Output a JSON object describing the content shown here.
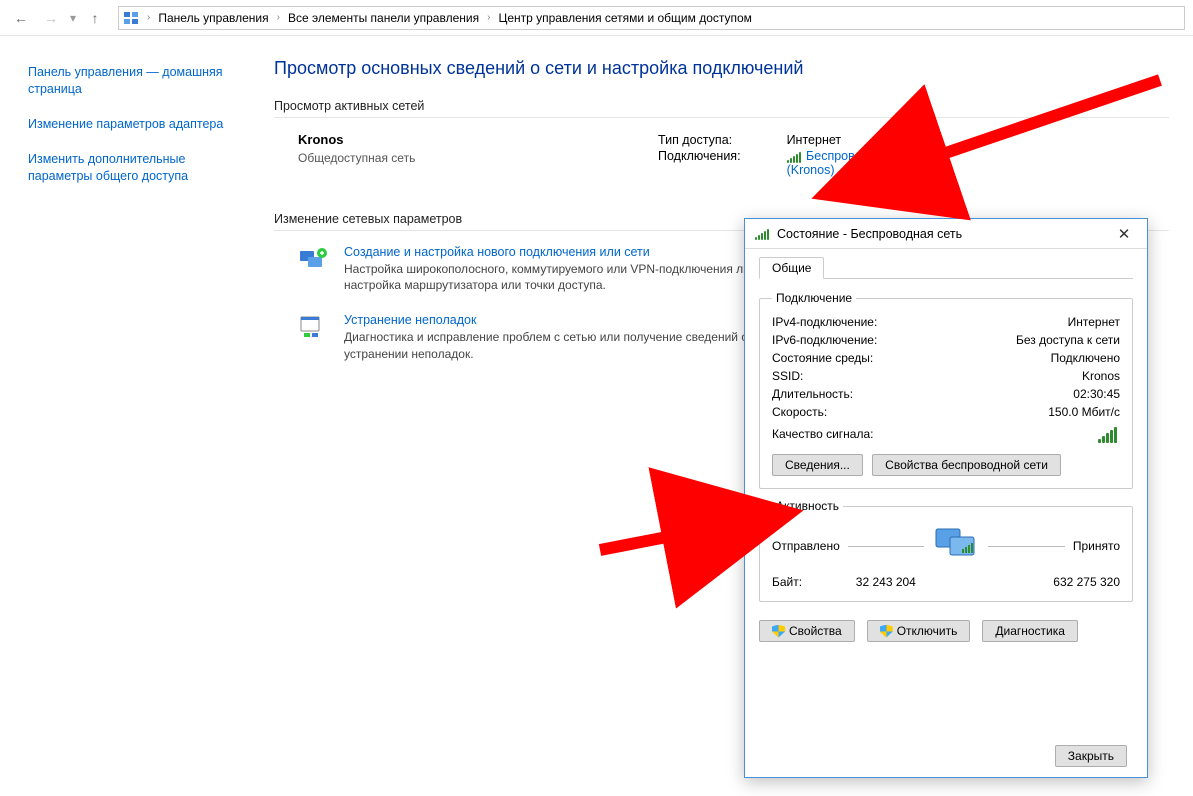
{
  "breadcrumb": {
    "root": "Панель управления",
    "l2": "Все элементы панели управления",
    "l3": "Центр управления сетями и общим доступом"
  },
  "sidebar": {
    "home": "Панель управления — домашняя страница",
    "adapter": "Изменение параметров адаптера",
    "sharing": "Изменить дополнительные параметры общего доступа"
  },
  "main": {
    "title": "Просмотр основных сведений о сети и настройка подключений",
    "active_head": "Просмотр активных сетей",
    "net_name": "Kronos",
    "net_profile": "Общедоступная сеть",
    "access_lbl": "Тип доступа:",
    "access_val": "Интернет",
    "conn_lbl": "Подключения:",
    "conn_link1": "Беспроводная сеть",
    "conn_link2": "(Kronos)",
    "change_head": "Изменение сетевых параметров",
    "item1_t": "Создание и настройка нового подключения или сети",
    "item1_d": "Настройка широкополосного, коммутируемого или VPN-подключения либо настройка маршрутизатора или точки доступа.",
    "item2_t": "Устранение неполадок",
    "item2_d": "Диагностика и исправление проблем с сетью или получение сведений об устранении неполадок."
  },
  "dialog": {
    "title": "Состояние - Беспроводная сеть",
    "tab": "Общие",
    "group_conn": "Подключение",
    "ipv4_k": "IPv4-подключение:",
    "ipv4_v": "Интернет",
    "ipv6_k": "IPv6-подключение:",
    "ipv6_v": "Без доступа к сети",
    "media_k": "Состояние среды:",
    "media_v": "Подключено",
    "ssid_k": "SSID:",
    "ssid_v": "Kronos",
    "dur_k": "Длительность:",
    "dur_v": "02:30:45",
    "speed_k": "Скорость:",
    "speed_v": "150.0 Мбит/с",
    "signal_k": "Качество сигнала:",
    "btn_details": "Сведения...",
    "btn_wprops": "Свойства беспроводной сети",
    "group_act": "Активность",
    "sent_lbl": "Отправлено",
    "recv_lbl": "Принято",
    "bytes_lbl": "Байт:",
    "sent_bytes": "32 243 204",
    "recv_bytes": "632 275 320",
    "btn_props": "Свойства",
    "btn_disc": "Отключить",
    "btn_diag": "Диагностика",
    "btn_close": "Закрыть"
  }
}
